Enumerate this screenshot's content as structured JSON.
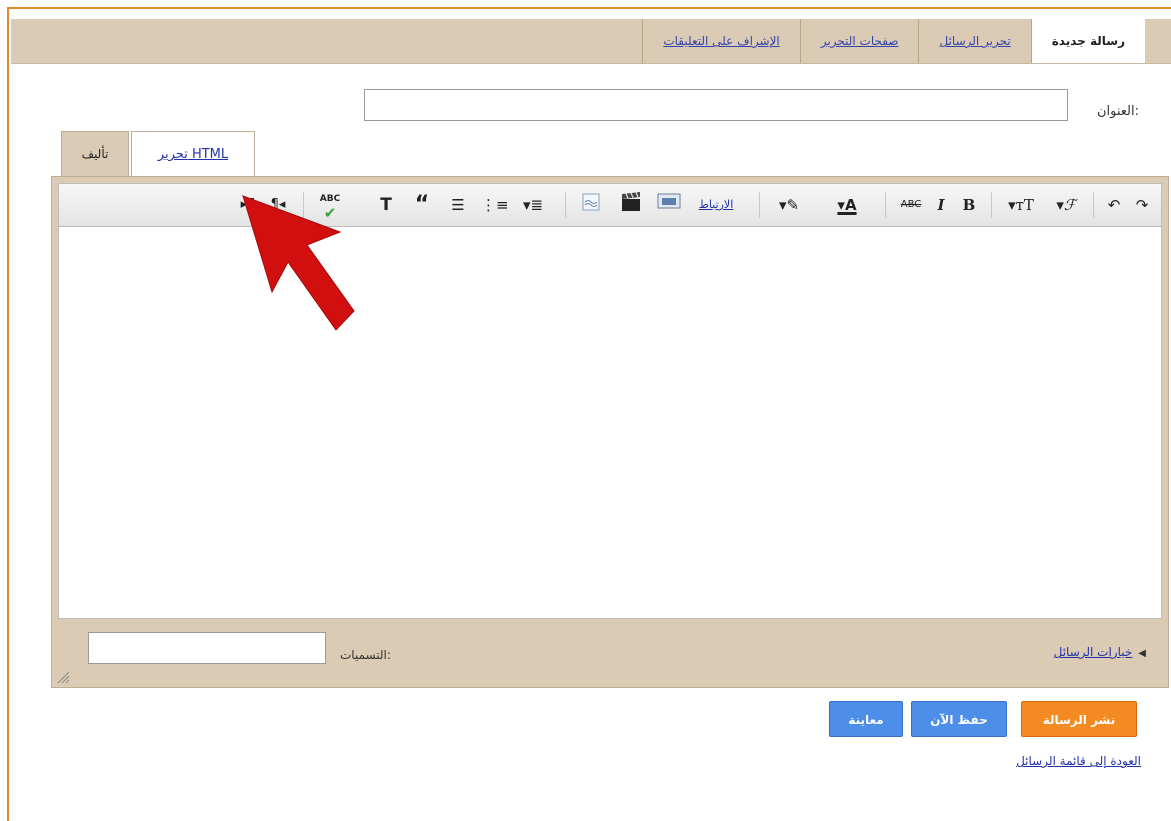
{
  "top_tabs": [
    {
      "label": "رسالة جديدة",
      "active": true
    },
    {
      "label": "تحرير الرسائل",
      "active": false
    },
    {
      "label": "صفحات التحرير",
      "active": false
    },
    {
      "label": "الإشراف على التعليقات",
      "active": false
    }
  ],
  "title_field": {
    "label": "العنوان:",
    "value": ""
  },
  "mode_tabs": {
    "compose": "تأليف",
    "html": "تحرير HTML"
  },
  "toolbar": {
    "link_label": "الارتباط",
    "bold": "B",
    "italic": "I",
    "strike": "ABC",
    "spell": "ABC"
  },
  "post_options": {
    "label": "خيارات الرسائل"
  },
  "labels_field": {
    "label": "التسميات:",
    "value": ""
  },
  "buttons": {
    "publish": "نشر الرسالة",
    "save": "حفظ الآن",
    "preview": "معاينة"
  },
  "back_link": "العودة إلى قائمة الرسائل",
  "colors": {
    "accent_orange": "#f48a22",
    "button_blue": "#4d8fe8",
    "tab_beige": "#dccbb4",
    "arrow_red": "#d10f0f"
  }
}
